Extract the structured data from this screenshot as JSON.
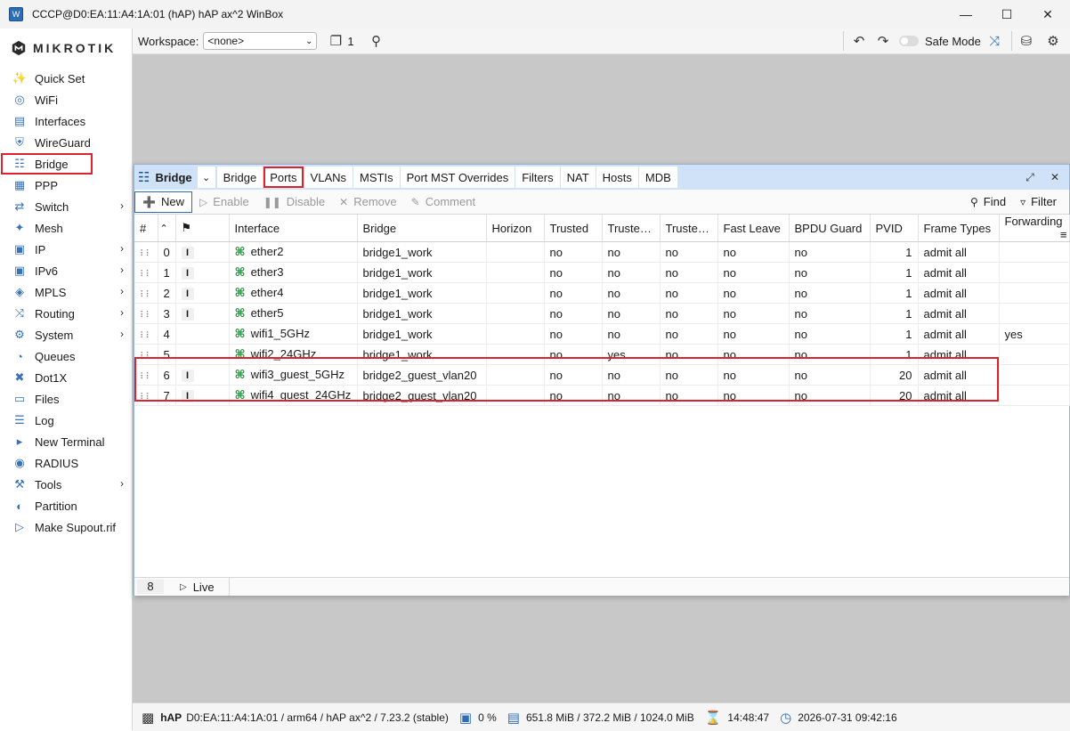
{
  "window": {
    "title": "CCCP@D0:EA:11:A4:1A:01 (hAP) hAP ax^2 WinBox",
    "controls": [
      "minimize-icon",
      "maximize-icon",
      "close-icon"
    ]
  },
  "logo": {
    "text": "MIKROTIK"
  },
  "sidebar": {
    "items": [
      {
        "label": "Quick Set",
        "icon": "wand-icon",
        "chevron": false
      },
      {
        "label": "WiFi",
        "icon": "wifi-icon",
        "chevron": false
      },
      {
        "label": "Interfaces",
        "icon": "interfaces-icon",
        "chevron": false
      },
      {
        "label": "WireGuard",
        "icon": "shield-icon",
        "chevron": false
      },
      {
        "label": "Bridge",
        "icon": "bridge-icon",
        "chevron": false,
        "selected": true
      },
      {
        "label": "PPP",
        "icon": "ppp-icon",
        "chevron": false
      },
      {
        "label": "Switch",
        "icon": "switch-icon",
        "chevron": true
      },
      {
        "label": "Mesh",
        "icon": "mesh-icon",
        "chevron": false
      },
      {
        "label": "IP",
        "icon": "ip-icon",
        "chevron": true
      },
      {
        "label": "IPv6",
        "icon": "ipv6-icon",
        "chevron": true
      },
      {
        "label": "MPLS",
        "icon": "tag-icon",
        "chevron": true
      },
      {
        "label": "Routing",
        "icon": "routing-icon",
        "chevron": true
      },
      {
        "label": "System",
        "icon": "gear-icon",
        "chevron": true
      },
      {
        "label": "Queues",
        "icon": "queues-icon",
        "chevron": false
      },
      {
        "label": "Dot1X",
        "icon": "dot1x-icon",
        "chevron": false
      },
      {
        "label": "Files",
        "icon": "folder-icon",
        "chevron": false
      },
      {
        "label": "Log",
        "icon": "log-icon",
        "chevron": false
      },
      {
        "label": "New Terminal",
        "icon": "terminal-icon",
        "chevron": false
      },
      {
        "label": "RADIUS",
        "icon": "radius-icon",
        "chevron": false
      },
      {
        "label": "Tools",
        "icon": "tools-icon",
        "chevron": true
      },
      {
        "label": "Partition",
        "icon": "partition-icon",
        "chevron": false
      },
      {
        "label": "Make Supout.rif",
        "icon": "supout-icon",
        "chevron": false
      }
    ]
  },
  "toolbar": {
    "workspace_label": "Workspace:",
    "workspace_value": "<none>",
    "window_count": "1",
    "safe_mode_label": "Safe Mode"
  },
  "panel": {
    "title": "Bridge",
    "tabs": [
      "Bridge",
      "Ports",
      "VLANs",
      "MSTIs",
      "Port MST Overrides",
      "Filters",
      "NAT",
      "Hosts",
      "MDB"
    ],
    "active_tab": "Ports",
    "actions": {
      "new": "New",
      "enable": "Enable",
      "disable": "Disable",
      "remove": "Remove",
      "comment": "Comment",
      "find": "Find",
      "filter": "Filter"
    },
    "columns": [
      "#",
      "",
      "Interface",
      "Bridge",
      "Horizon",
      "Trusted",
      "Trusted...",
      "Trusted...",
      "Fast Leave",
      "BPDU Guard",
      "PVID",
      "Frame Types",
      "Forwarding"
    ],
    "rows": [
      {
        "n": "0",
        "flag": "I",
        "iface": "ether2",
        "bridge": "bridge1_work",
        "horizon": "",
        "trusted": "no",
        "t2": "no",
        "t3": "no",
        "fast": "no",
        "bpdu": "no",
        "pvid": "1",
        "frame": "admit all",
        "fwd": ""
      },
      {
        "n": "1",
        "flag": "I",
        "iface": "ether3",
        "bridge": "bridge1_work",
        "horizon": "",
        "trusted": "no",
        "t2": "no",
        "t3": "no",
        "fast": "no",
        "bpdu": "no",
        "pvid": "1",
        "frame": "admit all",
        "fwd": ""
      },
      {
        "n": "2",
        "flag": "I",
        "iface": "ether4",
        "bridge": "bridge1_work",
        "horizon": "",
        "trusted": "no",
        "t2": "no",
        "t3": "no",
        "fast": "no",
        "bpdu": "no",
        "pvid": "1",
        "frame": "admit all",
        "fwd": ""
      },
      {
        "n": "3",
        "flag": "I",
        "iface": "ether5",
        "bridge": "bridge1_work",
        "horizon": "",
        "trusted": "no",
        "t2": "no",
        "t3": "no",
        "fast": "no",
        "bpdu": "no",
        "pvid": "1",
        "frame": "admit all",
        "fwd": ""
      },
      {
        "n": "4",
        "flag": "",
        "iface": "wifi1_5GHz",
        "bridge": "bridge1_work",
        "horizon": "",
        "trusted": "no",
        "t2": "no",
        "t3": "no",
        "fast": "no",
        "bpdu": "no",
        "pvid": "1",
        "frame": "admit all",
        "fwd": "yes"
      },
      {
        "n": "5",
        "flag": "",
        "iface": "wifi2_24GHz",
        "bridge": "bridge1_work",
        "horizon": "",
        "trusted": "no",
        "t2": "yes",
        "t3": "no",
        "fast": "no",
        "bpdu": "no",
        "pvid": "1",
        "frame": "admit all",
        "fwd": ""
      },
      {
        "n": "6",
        "flag": "I",
        "iface": "wifi3_guest_5GHz",
        "bridge": "bridge2_guest_vlan20",
        "horizon": "",
        "trusted": "no",
        "t2": "no",
        "t3": "no",
        "fast": "no",
        "bpdu": "no",
        "pvid": "20",
        "frame": "admit all",
        "fwd": ""
      },
      {
        "n": "7",
        "flag": "I",
        "iface": "wifi4_guest_24GHz",
        "bridge": "bridge2_guest_vlan20",
        "horizon": "",
        "trusted": "no",
        "t2": "no",
        "t3": "no",
        "fast": "no",
        "bpdu": "no",
        "pvid": "20",
        "frame": "admit all",
        "fwd": ""
      }
    ],
    "footer": {
      "count": "8",
      "live": "Live"
    }
  },
  "status": {
    "device": "hAP",
    "info": "D0:EA:11:A4:1A:01 / arm64 / hAP ax^2 / 7.23.2 (stable)",
    "cpu": "0 %",
    "memory": "651.8 MiB / 372.2 MiB / 1024.0 MiB",
    "uptime": "14:48:47",
    "datetime": "2026-07-31 09:42:16"
  },
  "colors": {
    "accent": "#2d6db5",
    "highlight": "#d9232d",
    "tabbar": "#cfe2f7",
    "workspace": "#c8c8c8"
  }
}
